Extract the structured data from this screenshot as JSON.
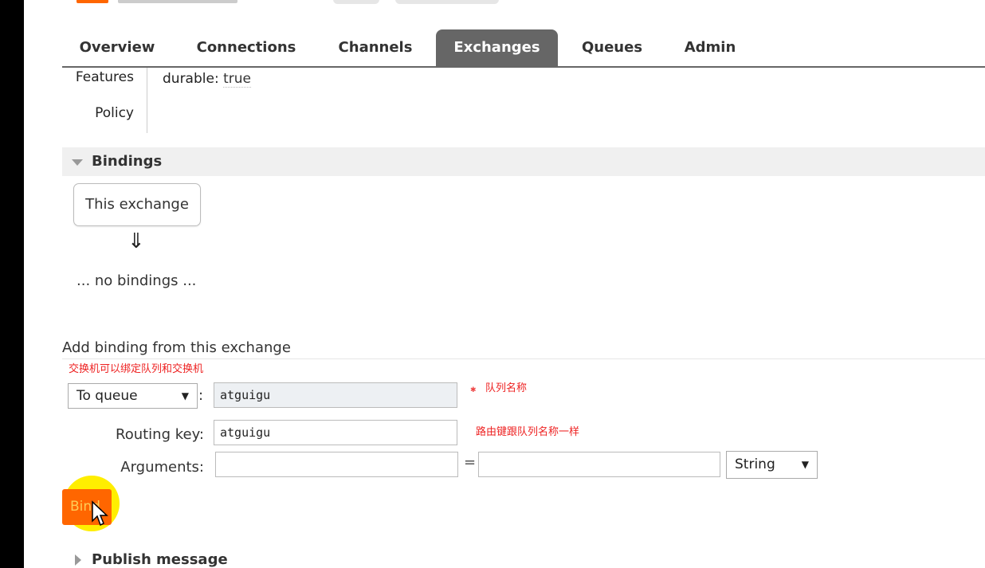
{
  "tabs": [
    {
      "label": "Overview"
    },
    {
      "label": "Connections"
    },
    {
      "label": "Channels"
    },
    {
      "label": "Exchanges",
      "active": true
    },
    {
      "label": "Queues"
    },
    {
      "label": "Admin"
    }
  ],
  "details": {
    "features_label": "Features",
    "features_key": "durable:",
    "features_value": "true",
    "policy_label": "Policy"
  },
  "bindings": {
    "title": "Bindings",
    "exchange_box": "This exchange",
    "arrow": "⇓",
    "empty_text": "... no bindings ..."
  },
  "add_binding": {
    "title": "Add binding from this exchange",
    "note_top": "交换机可以绑定队列和交换机",
    "destination_type": "To queue",
    "destination_value": "atguigu",
    "note_destination": "队列名称",
    "routing_key_label": "Routing key:",
    "routing_key_value": "atguigu",
    "note_routing": "路由键跟队列名称一样",
    "arguments_label": "Arguments:",
    "argument_key": "",
    "argument_value": "",
    "argument_type": "String",
    "bind_label": "Bind"
  },
  "publish": {
    "title": "Publish message"
  },
  "colors": {
    "tab_active_bg": "#666666",
    "bind_button": "#ff6600",
    "cursor_halo": "#ffee00",
    "note_red": "#ee2222"
  },
  "icons": [
    "collapse-triangle-icon",
    "expand-triangle-icon",
    "down-arrow-icon",
    "dropdown-caret-icon",
    "mouse-cursor-icon"
  ]
}
